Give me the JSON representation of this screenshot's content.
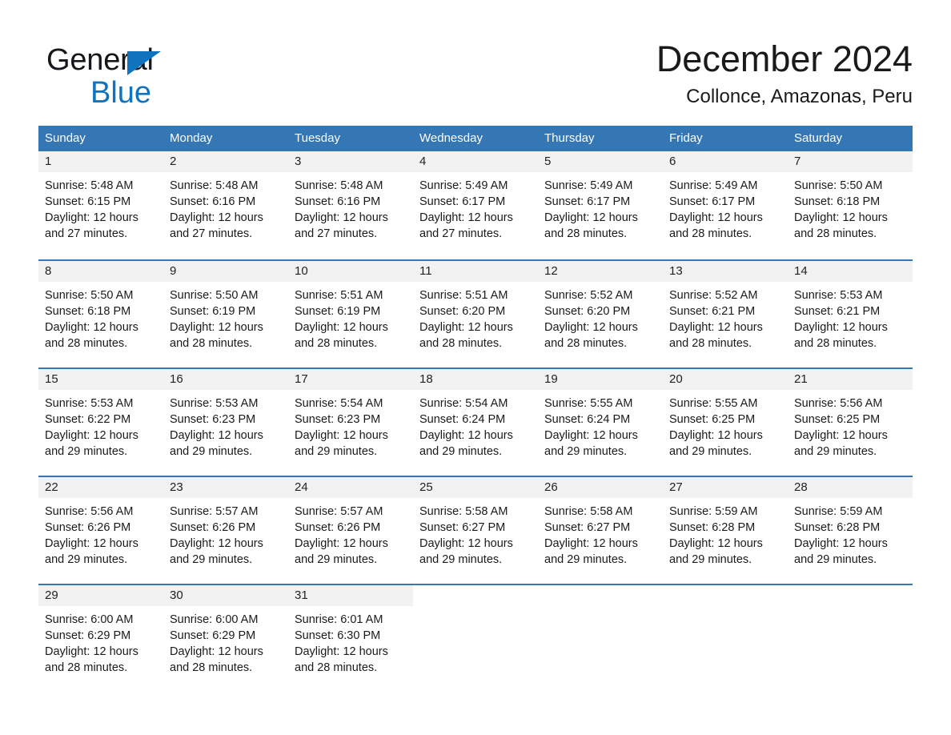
{
  "brand": {
    "name_top": "General",
    "name_bottom": "Blue",
    "accent_color": "#1073bd",
    "header_color": "#3576b5"
  },
  "header": {
    "title": "December 2024",
    "subtitle": "Collonce, Amazonas, Peru"
  },
  "calendar": {
    "weekday_headers": [
      "Sunday",
      "Monday",
      "Tuesday",
      "Wednesday",
      "Thursday",
      "Friday",
      "Saturday"
    ],
    "weeks": [
      [
        {
          "day": "1",
          "sunrise": "Sunrise: 5:48 AM",
          "sunset": "Sunset: 6:15 PM",
          "daylight_1": "Daylight: 12 hours",
          "daylight_2": "and 27 minutes."
        },
        {
          "day": "2",
          "sunrise": "Sunrise: 5:48 AM",
          "sunset": "Sunset: 6:16 PM",
          "daylight_1": "Daylight: 12 hours",
          "daylight_2": "and 27 minutes."
        },
        {
          "day": "3",
          "sunrise": "Sunrise: 5:48 AM",
          "sunset": "Sunset: 6:16 PM",
          "daylight_1": "Daylight: 12 hours",
          "daylight_2": "and 27 minutes."
        },
        {
          "day": "4",
          "sunrise": "Sunrise: 5:49 AM",
          "sunset": "Sunset: 6:17 PM",
          "daylight_1": "Daylight: 12 hours",
          "daylight_2": "and 27 minutes."
        },
        {
          "day": "5",
          "sunrise": "Sunrise: 5:49 AM",
          "sunset": "Sunset: 6:17 PM",
          "daylight_1": "Daylight: 12 hours",
          "daylight_2": "and 28 minutes."
        },
        {
          "day": "6",
          "sunrise": "Sunrise: 5:49 AM",
          "sunset": "Sunset: 6:17 PM",
          "daylight_1": "Daylight: 12 hours",
          "daylight_2": "and 28 minutes."
        },
        {
          "day": "7",
          "sunrise": "Sunrise: 5:50 AM",
          "sunset": "Sunset: 6:18 PM",
          "daylight_1": "Daylight: 12 hours",
          "daylight_2": "and 28 minutes."
        }
      ],
      [
        {
          "day": "8",
          "sunrise": "Sunrise: 5:50 AM",
          "sunset": "Sunset: 6:18 PM",
          "daylight_1": "Daylight: 12 hours",
          "daylight_2": "and 28 minutes."
        },
        {
          "day": "9",
          "sunrise": "Sunrise: 5:50 AM",
          "sunset": "Sunset: 6:19 PM",
          "daylight_1": "Daylight: 12 hours",
          "daylight_2": "and 28 minutes."
        },
        {
          "day": "10",
          "sunrise": "Sunrise: 5:51 AM",
          "sunset": "Sunset: 6:19 PM",
          "daylight_1": "Daylight: 12 hours",
          "daylight_2": "and 28 minutes."
        },
        {
          "day": "11",
          "sunrise": "Sunrise: 5:51 AM",
          "sunset": "Sunset: 6:20 PM",
          "daylight_1": "Daylight: 12 hours",
          "daylight_2": "and 28 minutes."
        },
        {
          "day": "12",
          "sunrise": "Sunrise: 5:52 AM",
          "sunset": "Sunset: 6:20 PM",
          "daylight_1": "Daylight: 12 hours",
          "daylight_2": "and 28 minutes."
        },
        {
          "day": "13",
          "sunrise": "Sunrise: 5:52 AM",
          "sunset": "Sunset: 6:21 PM",
          "daylight_1": "Daylight: 12 hours",
          "daylight_2": "and 28 minutes."
        },
        {
          "day": "14",
          "sunrise": "Sunrise: 5:53 AM",
          "sunset": "Sunset: 6:21 PM",
          "daylight_1": "Daylight: 12 hours",
          "daylight_2": "and 28 minutes."
        }
      ],
      [
        {
          "day": "15",
          "sunrise": "Sunrise: 5:53 AM",
          "sunset": "Sunset: 6:22 PM",
          "daylight_1": "Daylight: 12 hours",
          "daylight_2": "and 29 minutes."
        },
        {
          "day": "16",
          "sunrise": "Sunrise: 5:53 AM",
          "sunset": "Sunset: 6:23 PM",
          "daylight_1": "Daylight: 12 hours",
          "daylight_2": "and 29 minutes."
        },
        {
          "day": "17",
          "sunrise": "Sunrise: 5:54 AM",
          "sunset": "Sunset: 6:23 PM",
          "daylight_1": "Daylight: 12 hours",
          "daylight_2": "and 29 minutes."
        },
        {
          "day": "18",
          "sunrise": "Sunrise: 5:54 AM",
          "sunset": "Sunset: 6:24 PM",
          "daylight_1": "Daylight: 12 hours",
          "daylight_2": "and 29 minutes."
        },
        {
          "day": "19",
          "sunrise": "Sunrise: 5:55 AM",
          "sunset": "Sunset: 6:24 PM",
          "daylight_1": "Daylight: 12 hours",
          "daylight_2": "and 29 minutes."
        },
        {
          "day": "20",
          "sunrise": "Sunrise: 5:55 AM",
          "sunset": "Sunset: 6:25 PM",
          "daylight_1": "Daylight: 12 hours",
          "daylight_2": "and 29 minutes."
        },
        {
          "day": "21",
          "sunrise": "Sunrise: 5:56 AM",
          "sunset": "Sunset: 6:25 PM",
          "daylight_1": "Daylight: 12 hours",
          "daylight_2": "and 29 minutes."
        }
      ],
      [
        {
          "day": "22",
          "sunrise": "Sunrise: 5:56 AM",
          "sunset": "Sunset: 6:26 PM",
          "daylight_1": "Daylight: 12 hours",
          "daylight_2": "and 29 minutes."
        },
        {
          "day": "23",
          "sunrise": "Sunrise: 5:57 AM",
          "sunset": "Sunset: 6:26 PM",
          "daylight_1": "Daylight: 12 hours",
          "daylight_2": "and 29 minutes."
        },
        {
          "day": "24",
          "sunrise": "Sunrise: 5:57 AM",
          "sunset": "Sunset: 6:26 PM",
          "daylight_1": "Daylight: 12 hours",
          "daylight_2": "and 29 minutes."
        },
        {
          "day": "25",
          "sunrise": "Sunrise: 5:58 AM",
          "sunset": "Sunset: 6:27 PM",
          "daylight_1": "Daylight: 12 hours",
          "daylight_2": "and 29 minutes."
        },
        {
          "day": "26",
          "sunrise": "Sunrise: 5:58 AM",
          "sunset": "Sunset: 6:27 PM",
          "daylight_1": "Daylight: 12 hours",
          "daylight_2": "and 29 minutes."
        },
        {
          "day": "27",
          "sunrise": "Sunrise: 5:59 AM",
          "sunset": "Sunset: 6:28 PM",
          "daylight_1": "Daylight: 12 hours",
          "daylight_2": "and 29 minutes."
        },
        {
          "day": "28",
          "sunrise": "Sunrise: 5:59 AM",
          "sunset": "Sunset: 6:28 PM",
          "daylight_1": "Daylight: 12 hours",
          "daylight_2": "and 29 minutes."
        }
      ],
      [
        {
          "day": "29",
          "sunrise": "Sunrise: 6:00 AM",
          "sunset": "Sunset: 6:29 PM",
          "daylight_1": "Daylight: 12 hours",
          "daylight_2": "and 28 minutes."
        },
        {
          "day": "30",
          "sunrise": "Sunrise: 6:00 AM",
          "sunset": "Sunset: 6:29 PM",
          "daylight_1": "Daylight: 12 hours",
          "daylight_2": "and 28 minutes."
        },
        {
          "day": "31",
          "sunrise": "Sunrise: 6:01 AM",
          "sunset": "Sunset: 6:30 PM",
          "daylight_1": "Daylight: 12 hours",
          "daylight_2": "and 28 minutes."
        },
        {
          "day": "",
          "sunrise": "",
          "sunset": "",
          "daylight_1": "",
          "daylight_2": ""
        },
        {
          "day": "",
          "sunrise": "",
          "sunset": "",
          "daylight_1": "",
          "daylight_2": ""
        },
        {
          "day": "",
          "sunrise": "",
          "sunset": "",
          "daylight_1": "",
          "daylight_2": ""
        },
        {
          "day": "",
          "sunrise": "",
          "sunset": "",
          "daylight_1": "",
          "daylight_2": ""
        }
      ]
    ]
  }
}
